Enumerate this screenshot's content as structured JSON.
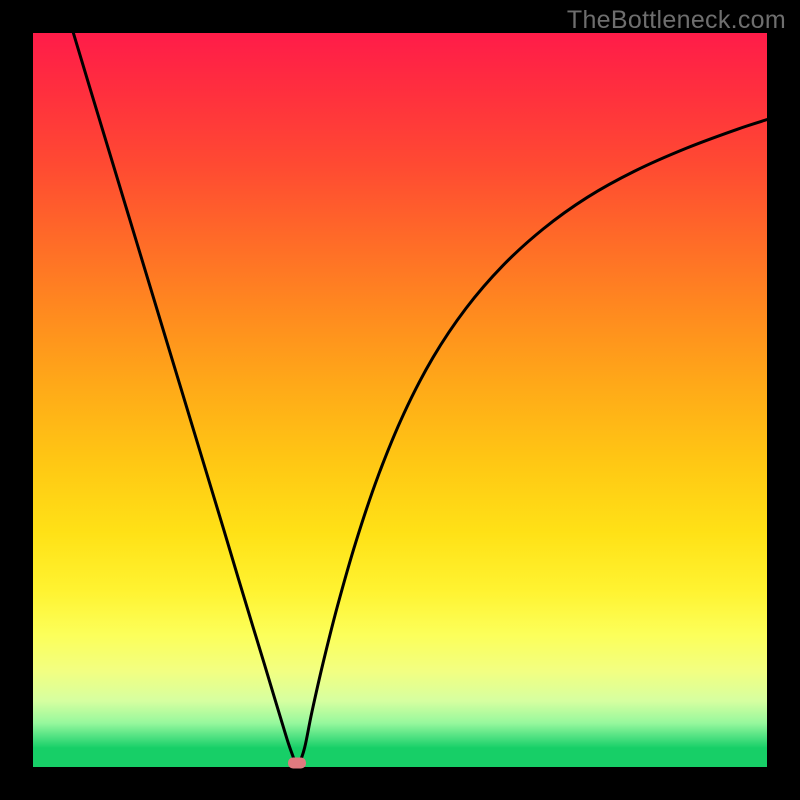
{
  "watermark": "TheBottleneck.com",
  "colors": {
    "curve": "#000000",
    "marker": "#e07a7f",
    "frame": "#000000"
  },
  "chart_data": {
    "type": "line",
    "title": "",
    "xlabel": "",
    "ylabel": "",
    "xlim": [
      0,
      100
    ],
    "ylim": [
      0,
      100
    ],
    "series": [
      {
        "name": "bottleneck-curve",
        "x": [
          5.5,
          8,
          11,
          14,
          17,
          20,
          23,
          26,
          28,
          30,
          31.5,
          33,
          34,
          34.8,
          35.4,
          35.8,
          36.2,
          37,
          38,
          39.5,
          41.5,
          44,
          47,
          50.5,
          54.5,
          59,
          64,
          69.5,
          75.5,
          82,
          89,
          96,
          100
        ],
        "y": [
          100,
          91.7,
          81.8,
          71.9,
          62,
          52.1,
          42.2,
          32.3,
          25.6,
          19,
          14.1,
          9.1,
          5.8,
          3.2,
          1.5,
          0.4,
          0.4,
          2.6,
          7.5,
          14.1,
          22,
          30.7,
          39.6,
          48.1,
          55.8,
          62.5,
          68.3,
          73.3,
          77.6,
          81.2,
          84.3,
          86.9,
          88.2
        ]
      }
    ],
    "marker": {
      "x": 36,
      "y": 0
    }
  }
}
